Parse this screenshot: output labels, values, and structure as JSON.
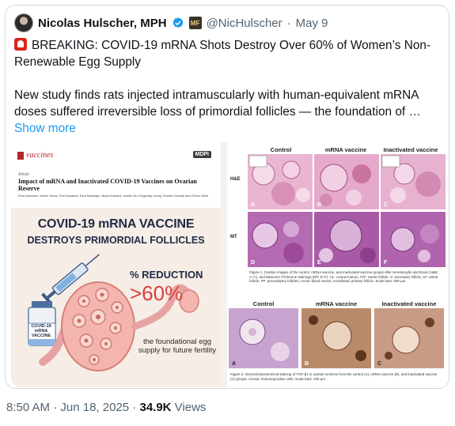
{
  "author": {
    "display_name": "Nicolas Hulscher, MPH",
    "handle": "@NicHulscher",
    "date": "May 9"
  },
  "tweet": {
    "headline": "BREAKING: COVID-19 mRNA Shots Destroy Over 60% of Women’s Non-Renewable Egg Supply",
    "body": "New study finds rats injected intramuscularly with human-equivalent mRNA doses suffered irreversible loss of primordial follicles — the foundation of …",
    "show_more": "Show more"
  },
  "media_left": {
    "journal": "vaccines",
    "publisher": "MDPI",
    "article_kind": "Article",
    "article_title": "Impact of mRNA and Inactivated COVID-19 Vaccines on Ovarian Reserve",
    "authors": "Esra Karaman, Adem Yavuz, Emi Kazakas, Esra Balcioglu, Busra Kazaca, Hande Nur Doganay, Koray Gorkem Saciati and Orhan Yildiz",
    "abstract_title_1": "COVID-19 mRNA VACCINE",
    "abstract_title_2": "DESTROYS PRIMORDIAL FOLLICLES",
    "pct_label": "% REDUCTION",
    "pct_value": ">60%",
    "vial_label": "COVID-19 mRNA VACCINE",
    "caption": "the foundational egg supply for future fertility"
  },
  "media_right": {
    "columns": [
      "Control",
      "mRNA vaccine",
      "Inactivated vaccine"
    ],
    "rows": [
      "H&E",
      "MT"
    ],
    "figure1_caption": "Figure 1. Ovarian images of the control, mRNA vaccine, and inactivated vaccine groups after Hematoxylin and Eosin (H&E; A–C), and Masson's Trichrome stainings (MT; D–F). CL: corpus luteum, ATF: atretic follicle, S: secondary follicle, AF: antral follicle, PF: preovulatory follicles, Arrow: blood vessel, Arrowhead: primary follicle. Scale bars: 500 µm.",
    "ihc_columns": [
      "Control",
      "mRNA vaccine",
      "Inactivated vaccine"
    ],
    "figure2_caption": "Figure 2. Immunohistochemical staining of TGF-β1 in ovarian sections from the control (A), mRNA vaccine (B), and inactivated vaccine (C) groups. Arrows: immunopositive cells. Scale bars: 100 µm."
  },
  "footer": {
    "time": "8:50 AM",
    "sep1": " · ",
    "date": "Jun 18, 2025",
    "sep2": " · ",
    "views_count": "34.9K",
    "views_label": " Views"
  },
  "colors": {
    "link": "#1d9bf0",
    "verified": "#1d9bf0",
    "muted": "#536471",
    "accent_red": "#d8403a"
  },
  "icons": [
    "avatar",
    "verified-badge-icon",
    "affiliate-badge-icon",
    "alarm-light-icon"
  ]
}
